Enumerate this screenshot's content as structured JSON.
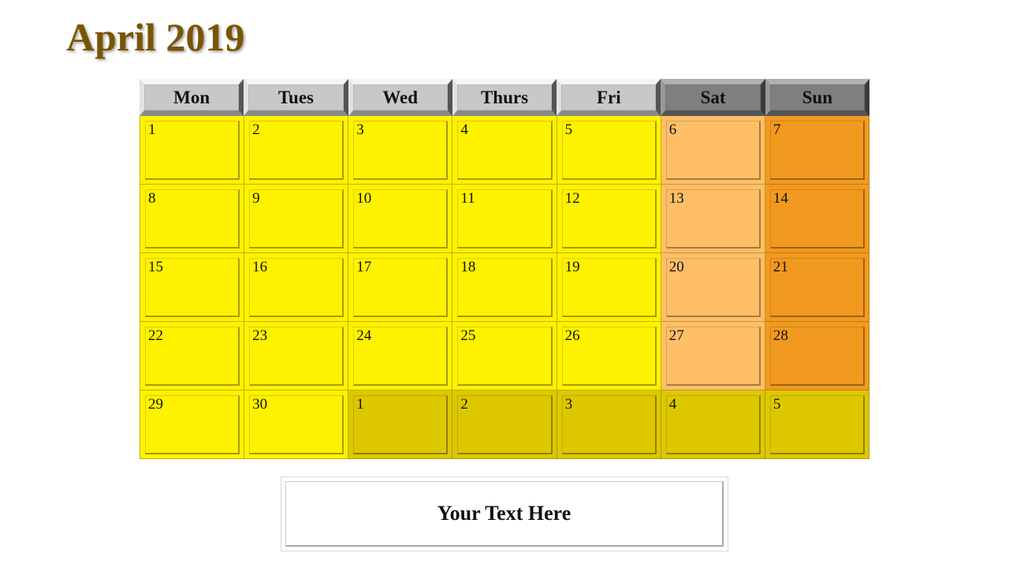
{
  "title": "April 2019",
  "colors": {
    "title": "#7a5500",
    "weekday_header": "#c8c8c8",
    "weekend_header": "#7f7f7f",
    "weekday_cell": "#fff200",
    "saturday_cell": "#ffbf66",
    "sunday_cell": "#f29920",
    "next_month_cell": "#ddc800"
  },
  "calendar": {
    "headers": [
      {
        "label": "Mon",
        "type": "weekday"
      },
      {
        "label": "Tues",
        "type": "weekday"
      },
      {
        "label": "Wed",
        "type": "weekday"
      },
      {
        "label": "Thurs",
        "type": "weekday"
      },
      {
        "label": "Fri",
        "type": "weekday"
      },
      {
        "label": "Sat",
        "type": "weekend"
      },
      {
        "label": "Sun",
        "type": "weekend"
      }
    ],
    "weeks": [
      [
        {
          "day": "1",
          "kind": "weekday"
        },
        {
          "day": "2",
          "kind": "weekday"
        },
        {
          "day": "3",
          "kind": "weekday"
        },
        {
          "day": "4",
          "kind": "weekday"
        },
        {
          "day": "5",
          "kind": "weekday"
        },
        {
          "day": "6",
          "kind": "saturday"
        },
        {
          "day": "7",
          "kind": "sunday"
        }
      ],
      [
        {
          "day": "8",
          "kind": "weekday"
        },
        {
          "day": "9",
          "kind": "weekday"
        },
        {
          "day": "10",
          "kind": "weekday"
        },
        {
          "day": "11",
          "kind": "weekday"
        },
        {
          "day": "12",
          "kind": "weekday"
        },
        {
          "day": "13",
          "kind": "saturday"
        },
        {
          "day": "14",
          "kind": "sunday"
        }
      ],
      [
        {
          "day": "15",
          "kind": "weekday"
        },
        {
          "day": "16",
          "kind": "weekday"
        },
        {
          "day": "17",
          "kind": "weekday"
        },
        {
          "day": "18",
          "kind": "weekday"
        },
        {
          "day": "19",
          "kind": "weekday"
        },
        {
          "day": "20",
          "kind": "saturday"
        },
        {
          "day": "21",
          "kind": "sunday"
        }
      ],
      [
        {
          "day": "22",
          "kind": "weekday"
        },
        {
          "day": "23",
          "kind": "weekday"
        },
        {
          "day": "24",
          "kind": "weekday"
        },
        {
          "day": "25",
          "kind": "weekday"
        },
        {
          "day": "26",
          "kind": "weekday"
        },
        {
          "day": "27",
          "kind": "saturday"
        },
        {
          "day": "28",
          "kind": "sunday"
        }
      ],
      [
        {
          "day": "29",
          "kind": "weekday"
        },
        {
          "day": "30",
          "kind": "weekday"
        },
        {
          "day": "1",
          "kind": "next_month"
        },
        {
          "day": "2",
          "kind": "next_month"
        },
        {
          "day": "3",
          "kind": "next_month"
        },
        {
          "day": "4",
          "kind": "next_month"
        },
        {
          "day": "5",
          "kind": "next_month"
        }
      ]
    ]
  },
  "textbox": {
    "text": "Your Text Here"
  }
}
